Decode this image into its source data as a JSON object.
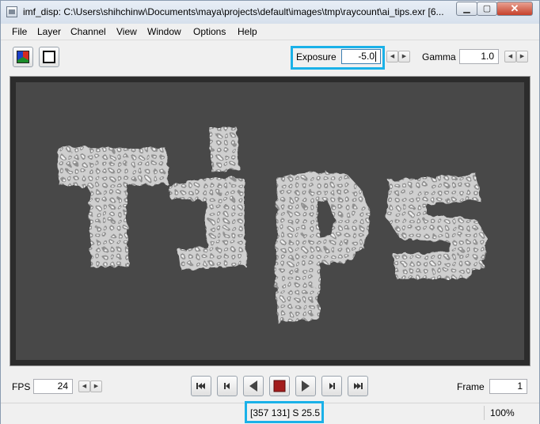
{
  "window": {
    "title": "imf_disp: C:\\Users\\shihchinw\\Documents\\maya\\projects\\default\\images\\tmp\\raycount\\ai_tips.exr [6...",
    "min_glyph": "▁",
    "max_glyph": "▢",
    "close_glyph": "✕"
  },
  "menu": [
    "File",
    "Layer",
    "Channel",
    "View",
    "Window",
    "Options",
    "Help"
  ],
  "toolbar": {
    "exposure_label": "Exposure",
    "exposure_value": "-5.0",
    "gamma_label": "Gamma",
    "gamma_value": "1.0",
    "spin_left": "◀",
    "spin_right": "▶"
  },
  "image": {
    "text": "Tips",
    "highlight_color": "#1ab1e8"
  },
  "playback": {
    "fps_label": "FPS",
    "fps_value": "24",
    "frame_label": "Frame",
    "frame_value": "1"
  },
  "status": {
    "pixel_info": "[357 131]  S 25.5",
    "zoom": "100%"
  }
}
